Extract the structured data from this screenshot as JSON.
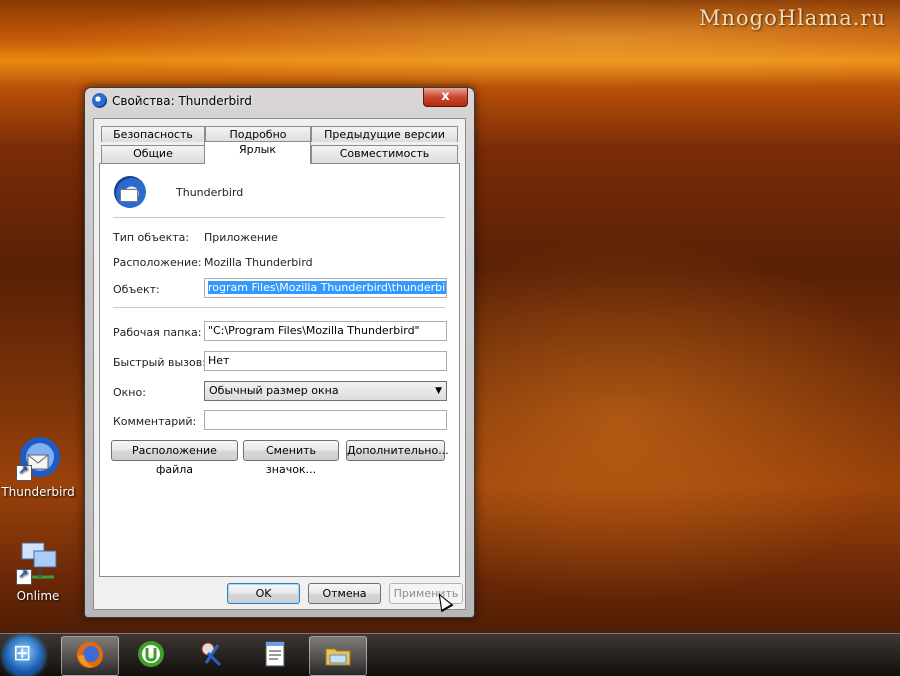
{
  "watermark": "MnogoHlama.ru",
  "desktop": {
    "icons": [
      {
        "label": "Thunderbird",
        "icon": "thunderbird-icon"
      },
      {
        "label": "Onlime",
        "icon": "network-connection-icon"
      }
    ]
  },
  "dialog": {
    "title": "Свойства: Thunderbird",
    "close_label": "x",
    "tabs_row1": [
      "Безопасность",
      "Подробно",
      "Предыдущие версии"
    ],
    "tabs_row2": [
      "Общие",
      "Ярлык",
      "Совместимость"
    ],
    "active_tab": "Ярлык",
    "app_name": "Thunderbird",
    "fields": {
      "type_label": "Тип объекта:",
      "type_value": "Приложение",
      "location_label": "Расположение:",
      "location_value": "Mozilla Thunderbird",
      "target_label": "Объект:",
      "target_value": "rogram Files\\Mozilla Thunderbird\\thunderbird.exe\"",
      "workdir_label": "Рабочая папка:",
      "workdir_value": "\"C:\\Program Files\\Mozilla Thunderbird\"",
      "hotkey_label": "Быстрый вызов:",
      "hotkey_value": "Нет",
      "window_label": "Окно:",
      "window_value": "Обычный размер окна",
      "comment_label": "Комментарий:",
      "comment_value": ""
    },
    "buttons": {
      "file_location": "Расположение файла",
      "change_icon": "Сменить значок...",
      "advanced": "Дополнительно...",
      "ok": "OK",
      "cancel": "Отмена",
      "apply": "Применить"
    }
  },
  "taskbar": {
    "items": [
      "start-orb",
      "firefox-icon",
      "utorrent-icon",
      "scissors-icon",
      "notepad-icon",
      "explorer-folder-icon"
    ]
  },
  "colors": {
    "selection": "#3399ff",
    "close_button": "#c94a30"
  }
}
